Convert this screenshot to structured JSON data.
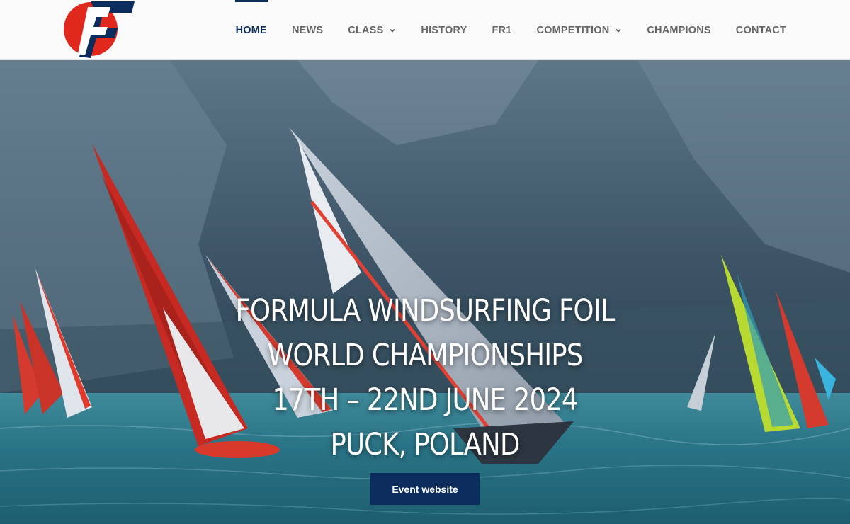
{
  "header": {
    "logo_icon": "formula-windsurfing-logo",
    "nav": [
      {
        "label": "HOME",
        "active": true
      },
      {
        "label": "NEWS"
      },
      {
        "label": "CLASS",
        "dropdown": true
      },
      {
        "label": "HISTORY"
      },
      {
        "label": "FR1"
      },
      {
        "label": "COMPETITION",
        "dropdown": true
      },
      {
        "label": "CHAMPIONS"
      },
      {
        "label": "CONTACT"
      }
    ]
  },
  "hero": {
    "lines": [
      "FORMULA WINDSURFING FOIL",
      "WORLD CHAMPIONSHIPS",
      "17TH – 22ND JUNE 2024",
      "PUCK, POLAND"
    ],
    "cta_label": "Event website",
    "image": "windsurfers-racing-on-lake-photo"
  },
  "colors": {
    "brand_navy": "#0b2c5c",
    "logo_red": "#e0281c",
    "nav_text": "#666666"
  }
}
